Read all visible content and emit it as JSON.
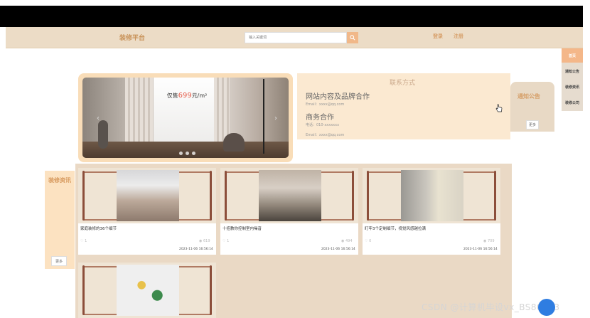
{
  "header": {
    "brand": "装修平台",
    "search_placeholder": "输入关键词",
    "login": "登录",
    "register": "注册"
  },
  "rightnav": {
    "items": [
      {
        "label": "首页",
        "active": true
      },
      {
        "label": "通知公告",
        "active": false
      },
      {
        "label": "装修资讯",
        "active": false
      },
      {
        "label": "装修公司",
        "active": false
      }
    ]
  },
  "banner": {
    "promo_title_prefix": "仅售",
    "promo_price": "699",
    "promo_title_suffix": "元/m²"
  },
  "contact": {
    "title": "联系方式",
    "sections": [
      {
        "heading": "网站内容及品牌合作",
        "line": "Email：xxxx@qq.com"
      },
      {
        "heading": "商务合作",
        "line": "电话：010-xxxxxxx"
      }
    ],
    "footer_line": "Email：xxxx@qq.com"
  },
  "notice": {
    "title": "通知公告",
    "more": "更多"
  },
  "news": {
    "title": "装修资讯",
    "more": "更多",
    "cards": [
      {
        "title": "家庭装修的36个细节",
        "likes": "1",
        "views": "619",
        "time": "2023-11-06 16:56:14"
      },
      {
        "title": "十招教你控制室内噪音",
        "likes": "1",
        "views": "494",
        "time": "2023-11-06 16:56:14"
      },
      {
        "title": "盯牢3个定制细节，视觉风感越拉满",
        "likes": "0",
        "views": "709",
        "time": "2023-11-06 16:56:14"
      }
    ]
  },
  "watermark": "CSDN @计算机毕设vx_BS80813",
  "colors": {
    "header_bg": "#ecdcc6",
    "accent": "#f4b789",
    "brand_text": "#c9935a"
  }
}
